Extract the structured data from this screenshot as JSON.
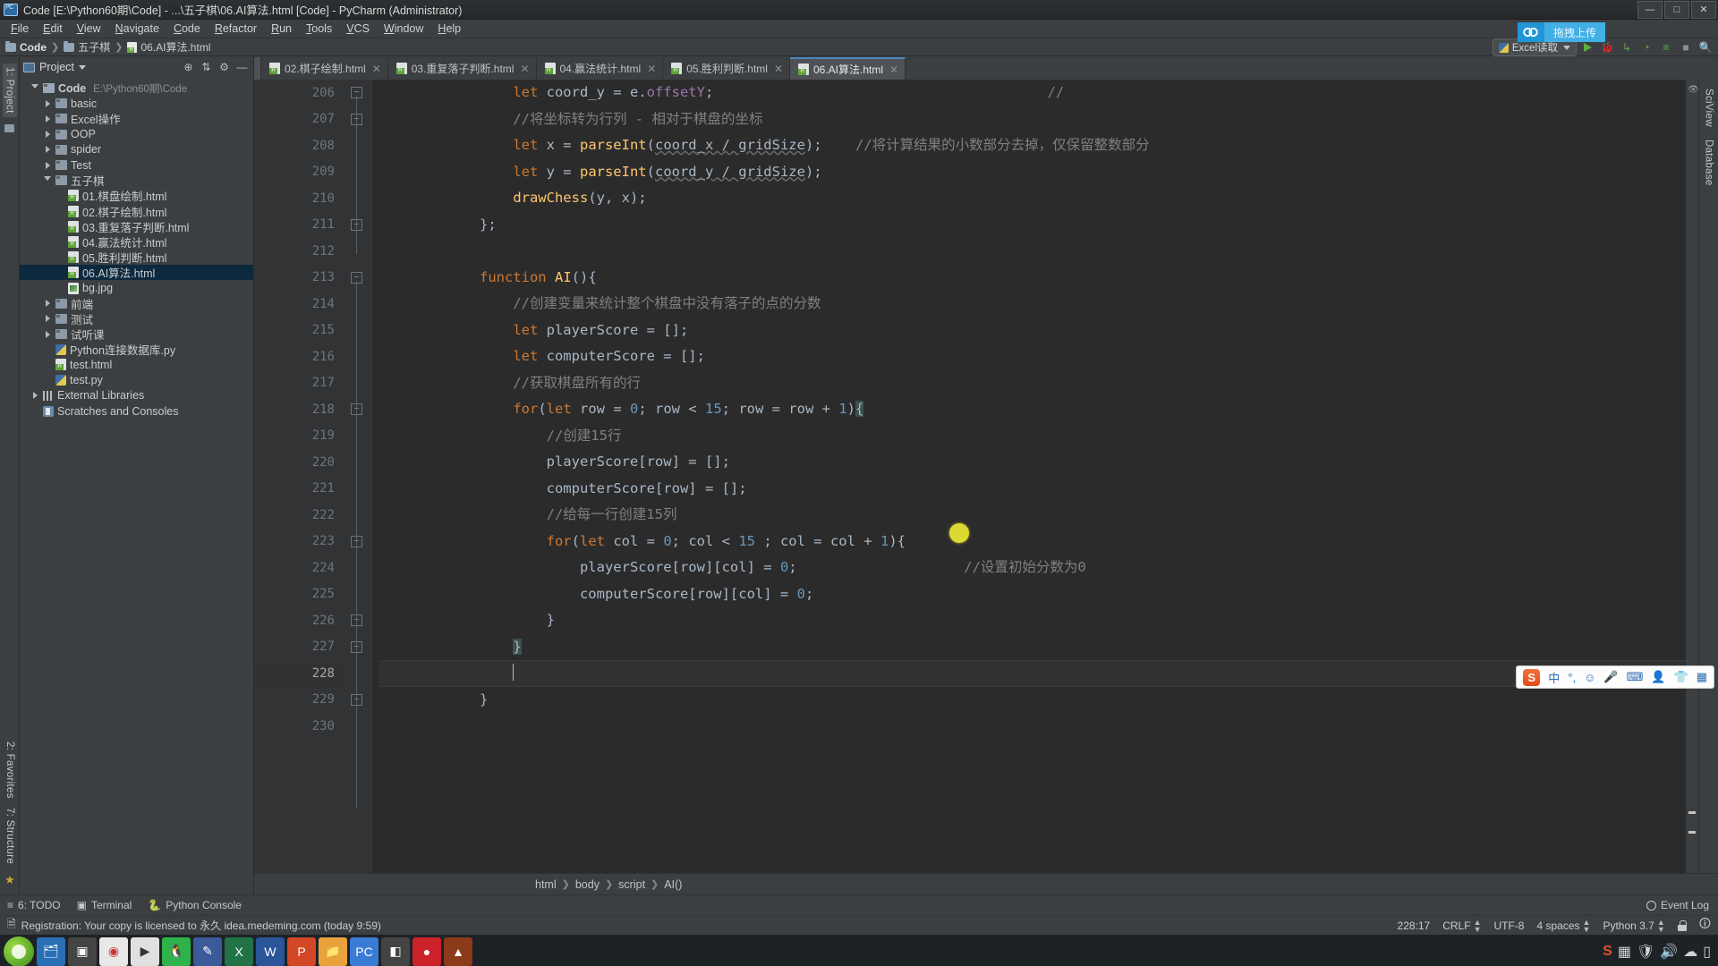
{
  "window": {
    "title": "Code [E:\\Python60期\\Code] - ...\\五子棋\\06.AI算法.html [Code] - PyCharm (Administrator)",
    "icon": "pycharm-icon",
    "minimize": "—",
    "maximize": "□",
    "close": "✕"
  },
  "menu": [
    "File",
    "Edit",
    "View",
    "Navigate",
    "Code",
    "Refactor",
    "Run",
    "Tools",
    "VCS",
    "Window",
    "Help"
  ],
  "navbar": {
    "items": [
      "Code",
      "五子棋",
      "06.AI算法.html"
    ]
  },
  "toolbar": {
    "run_config": "Excel读取",
    "upload_label": "拖拽上传"
  },
  "project": {
    "title": "Project",
    "tree": [
      {
        "label": "Code",
        "path": "E:\\Python60期\\Code",
        "depth": 0,
        "type": "folder-root",
        "arrow": "open"
      },
      {
        "label": "basic",
        "depth": 1,
        "type": "folder",
        "arrow": "closed"
      },
      {
        "label": "Excel操作",
        "depth": 1,
        "type": "folder",
        "arrow": "closed"
      },
      {
        "label": "OOP",
        "depth": 1,
        "type": "folder",
        "arrow": "closed"
      },
      {
        "label": "spider",
        "depth": 1,
        "type": "folder",
        "arrow": "closed"
      },
      {
        "label": "Test",
        "depth": 1,
        "type": "folder",
        "arrow": "closed"
      },
      {
        "label": "五子棋",
        "depth": 1,
        "type": "folder",
        "arrow": "open"
      },
      {
        "label": "01.棋盘绘制.html",
        "depth": 2,
        "type": "html"
      },
      {
        "label": "02.棋子绘制.html",
        "depth": 2,
        "type": "html"
      },
      {
        "label": "03.重复落子判断.html",
        "depth": 2,
        "type": "html"
      },
      {
        "label": "04.赢法统计.html",
        "depth": 2,
        "type": "html"
      },
      {
        "label": "05.胜利判断.html",
        "depth": 2,
        "type": "html"
      },
      {
        "label": "06.AI算法.html",
        "depth": 2,
        "type": "html",
        "selected": true
      },
      {
        "label": "bg.jpg",
        "depth": 2,
        "type": "image"
      },
      {
        "label": "前端",
        "depth": 1,
        "type": "folder",
        "arrow": "closed"
      },
      {
        "label": "测试",
        "depth": 1,
        "type": "folder",
        "arrow": "closed"
      },
      {
        "label": "试听课",
        "depth": 1,
        "type": "folder",
        "arrow": "closed"
      },
      {
        "label": "Python连接数据库.py",
        "depth": 1,
        "type": "python"
      },
      {
        "label": "test.html",
        "depth": 1,
        "type": "html"
      },
      {
        "label": "test.py",
        "depth": 1,
        "type": "python"
      },
      {
        "label": "External Libraries",
        "depth": 0,
        "type": "library",
        "arrow": "closed"
      },
      {
        "label": "Scratches and Consoles",
        "depth": 0,
        "type": "scratch"
      }
    ]
  },
  "left_strip": {
    "project_label": "1: Project",
    "structure_label": "7: Structure",
    "favorites_label": "2: Favorites"
  },
  "right_strip": {
    "sciview_label": "SciView",
    "database_label": "Database"
  },
  "tabs": [
    {
      "label": "02.棋子绘制.html",
      "active": false
    },
    {
      "label": "03.重复落子判断.html",
      "active": false
    },
    {
      "label": "04.赢法统计.html",
      "active": false
    },
    {
      "label": "05.胜利判断.html",
      "active": false
    },
    {
      "label": "06.AI算法.html",
      "active": true
    }
  ],
  "editor": {
    "first_line": 206,
    "lines": [
      {
        "n": 206,
        "fold": "collapsed-top",
        "segs": [
          {
            "t": "                ",
            "c": ""
          },
          {
            "t": "let",
            "c": "kw"
          },
          {
            "t": " coord_y = e.",
            "c": ""
          },
          {
            "t": "offsetY",
            "c": "prop"
          },
          {
            "t": ";",
            "c": ""
          },
          {
            "t": "                                        ",
            "c": ""
          },
          {
            "t": "//",
            "c": "cm"
          }
        ]
      },
      {
        "n": 207,
        "fold": "box",
        "segs": [
          {
            "t": "                ",
            "c": ""
          },
          {
            "t": "//将坐标转为行列 - 相对于棋盘的坐标",
            "c": "cm"
          }
        ]
      },
      {
        "n": 208,
        "fold": "",
        "segs": [
          {
            "t": "                ",
            "c": ""
          },
          {
            "t": "let",
            "c": "kw"
          },
          {
            "t": " x = ",
            "c": ""
          },
          {
            "t": "parseInt",
            "c": "fn"
          },
          {
            "t": "(",
            "c": ""
          },
          {
            "t": "coord_x / gridSize",
            "c": "undl"
          },
          {
            "t": ");",
            "c": ""
          },
          {
            "t": "    ",
            "c": ""
          },
          {
            "t": "//将计算结果的小数部分去掉，仅保留整数部分",
            "c": "cm"
          }
        ]
      },
      {
        "n": 209,
        "fold": "",
        "segs": [
          {
            "t": "                ",
            "c": ""
          },
          {
            "t": "let",
            "c": "kw"
          },
          {
            "t": " y = ",
            "c": ""
          },
          {
            "t": "parseInt",
            "c": "fn"
          },
          {
            "t": "(",
            "c": ""
          },
          {
            "t": "coord_y / gridSize",
            "c": "undl"
          },
          {
            "t": ");",
            "c": ""
          }
        ]
      },
      {
        "n": 210,
        "fold": "",
        "segs": [
          {
            "t": "                ",
            "c": ""
          },
          {
            "t": "drawChess",
            "c": "fn"
          },
          {
            "t": "(y, x);",
            "c": ""
          }
        ]
      },
      {
        "n": 211,
        "fold": "box",
        "segs": [
          {
            "t": "            };",
            "c": ""
          }
        ]
      },
      {
        "n": 212,
        "fold": "",
        "segs": [
          {
            "t": "",
            "c": ""
          }
        ]
      },
      {
        "n": 213,
        "fold": "collapsed-top",
        "segs": [
          {
            "t": "            ",
            "c": ""
          },
          {
            "t": "function",
            "c": "kw"
          },
          {
            "t": " ",
            "c": ""
          },
          {
            "t": "AI",
            "c": "fn"
          },
          {
            "t": "(){",
            "c": ""
          }
        ]
      },
      {
        "n": 214,
        "fold": "",
        "segs": [
          {
            "t": "                ",
            "c": ""
          },
          {
            "t": "//创建变量来统计整个棋盘中没有落子的点的分数",
            "c": "cm"
          }
        ]
      },
      {
        "n": 215,
        "fold": "",
        "segs": [
          {
            "t": "                ",
            "c": ""
          },
          {
            "t": "let",
            "c": "kw"
          },
          {
            "t": " playerScore = [];",
            "c": ""
          }
        ]
      },
      {
        "n": 216,
        "fold": "",
        "segs": [
          {
            "t": "                ",
            "c": ""
          },
          {
            "t": "let",
            "c": "kw"
          },
          {
            "t": " computerScore = [];",
            "c": ""
          }
        ]
      },
      {
        "n": 217,
        "fold": "",
        "segs": [
          {
            "t": "                ",
            "c": ""
          },
          {
            "t": "//获取棋盘所有的行",
            "c": "cm"
          }
        ]
      },
      {
        "n": 218,
        "fold": "collapsed-top",
        "segs": [
          {
            "t": "                ",
            "c": ""
          },
          {
            "t": "for",
            "c": "kw"
          },
          {
            "t": "(",
            "c": ""
          },
          {
            "t": "let",
            "c": "kw"
          },
          {
            "t": " row = ",
            "c": ""
          },
          {
            "t": "0",
            "c": "num"
          },
          {
            "t": "; row < ",
            "c": ""
          },
          {
            "t": "15",
            "c": "num"
          },
          {
            "t": "; row = row + ",
            "c": ""
          },
          {
            "t": "1",
            "c": "num"
          },
          {
            "t": ")",
            "c": ""
          },
          {
            "t": "{",
            "c": "hl"
          }
        ]
      },
      {
        "n": 219,
        "fold": "",
        "segs": [
          {
            "t": "                    ",
            "c": ""
          },
          {
            "t": "//创建15行",
            "c": "cm"
          }
        ]
      },
      {
        "n": 220,
        "fold": "",
        "segs": [
          {
            "t": "                    playerScore[row] = [];",
            "c": ""
          }
        ]
      },
      {
        "n": 221,
        "fold": "",
        "segs": [
          {
            "t": "                    computerScore[row] = [];",
            "c": ""
          }
        ]
      },
      {
        "n": 222,
        "fold": "",
        "segs": [
          {
            "t": "                    ",
            "c": ""
          },
          {
            "t": "//给每一行创建15列",
            "c": "cm"
          }
        ]
      },
      {
        "n": 223,
        "fold": "collapsed-top",
        "segs": [
          {
            "t": "                    ",
            "c": ""
          },
          {
            "t": "for",
            "c": "kw"
          },
          {
            "t": "(",
            "c": ""
          },
          {
            "t": "let",
            "c": "kw"
          },
          {
            "t": " col = ",
            "c": ""
          },
          {
            "t": "0",
            "c": "num"
          },
          {
            "t": "; col < ",
            "c": ""
          },
          {
            "t": "15",
            "c": "num"
          },
          {
            "t": " ; col = col + ",
            "c": ""
          },
          {
            "t": "1",
            "c": "num"
          },
          {
            "t": "){",
            "c": ""
          }
        ]
      },
      {
        "n": 224,
        "fold": "",
        "segs": [
          {
            "t": "                        playerScore[row][col] = ",
            "c": ""
          },
          {
            "t": "0",
            "c": "num"
          },
          {
            "t": ";",
            "c": ""
          },
          {
            "t": "                    ",
            "c": ""
          },
          {
            "t": "//设置初始分数为0",
            "c": "cm"
          }
        ]
      },
      {
        "n": 225,
        "fold": "",
        "segs": [
          {
            "t": "                        computerScore[row][col] = ",
            "c": ""
          },
          {
            "t": "0",
            "c": "num"
          },
          {
            "t": ";",
            "c": ""
          }
        ]
      },
      {
        "n": 226,
        "fold": "box",
        "segs": [
          {
            "t": "                    }",
            "c": ""
          }
        ]
      },
      {
        "n": 227,
        "fold": "box",
        "segs": [
          {
            "t": "                ",
            "c": ""
          },
          {
            "t": "}",
            "c": "hl"
          }
        ]
      },
      {
        "n": 228,
        "fold": "",
        "current": true,
        "caret": true,
        "segs": [
          {
            "t": "                ",
            "c": ""
          }
        ]
      },
      {
        "n": 229,
        "fold": "box",
        "segs": [
          {
            "t": "            }",
            "c": ""
          }
        ]
      },
      {
        "n": 230,
        "fold": "",
        "segs": [
          {
            "t": "",
            "c": ""
          }
        ]
      }
    ],
    "breadcrumb": [
      "html",
      "body",
      "script",
      "AI()"
    ]
  },
  "bottom_tools": [
    {
      "label": "6: TODO",
      "icon": "todo-icon"
    },
    {
      "label": "Terminal",
      "icon": "terminal-icon"
    },
    {
      "label": "Python Console",
      "icon": "python-icon"
    }
  ],
  "event_log": "Event Log",
  "status": {
    "registration": "Registration: Your copy is licensed to 永久 idea.medeming.com (today 9:59)",
    "caret": "228:17",
    "line_sep": "CRLF",
    "encoding": "UTF-8",
    "indent": "4 spaces",
    "interpreter": "Python 3.7"
  },
  "ime": {
    "logo": "S",
    "mode": "中",
    "items": [
      "punctuation-icon",
      "emoji-icon",
      "mic-icon",
      "keyboard-icon",
      "user-icon",
      "skin-icon",
      "apps-icon"
    ]
  },
  "colors": {
    "accent_blue": "#4a88c7",
    "keyword": "#cc7832",
    "comment": "#808080",
    "number": "#6897bb",
    "function": "#ffc66d",
    "property": "#9876aa",
    "default_text": "#a9b7c6",
    "editor_bg": "#2b2b2b",
    "panel_bg": "#3c3f41",
    "selection": "#0d293e",
    "marker_dot": "#ddd933"
  }
}
